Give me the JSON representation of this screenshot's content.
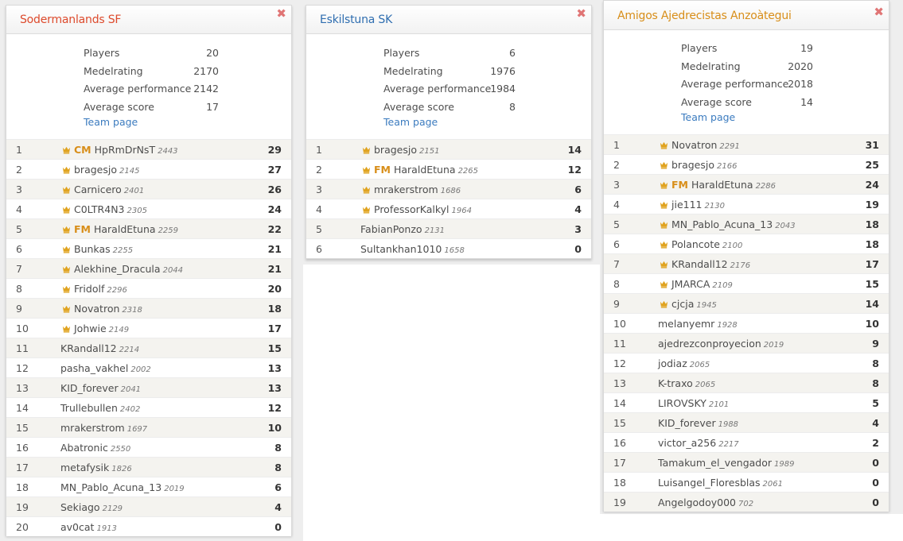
{
  "colors": {
    "team1_title": "#dd4a2c",
    "team2_title": "#2f6eb0",
    "team3_title": "#d88e19",
    "crown": "#e0a31f",
    "title_badge": "#d88e19",
    "link": "#3b7bbf",
    "close": "#e07575"
  },
  "icons": {
    "close": "close-icon",
    "crown": "crown-icon"
  },
  "labels": {
    "players": "Players",
    "medelrating": "Medelrating",
    "average_performance": "Average performance",
    "average_score": "Average score",
    "team_page": "Team page",
    "close_glyph": "✖"
  },
  "teams": [
    {
      "name": "Sodermanlands SF",
      "stats": {
        "players": "20",
        "medelrating": "2170",
        "average_performance": "2142",
        "average_score": "17"
      },
      "players": [
        {
          "rank": "1",
          "crown": true,
          "title": "CM",
          "name": "HpRmDrNsT",
          "rating": "2443",
          "score": "29"
        },
        {
          "rank": "2",
          "crown": true,
          "title": "",
          "name": "bragesjo",
          "rating": "2145",
          "score": "27"
        },
        {
          "rank": "3",
          "crown": true,
          "title": "",
          "name": "Carnicero",
          "rating": "2401",
          "score": "26"
        },
        {
          "rank": "4",
          "crown": true,
          "title": "",
          "name": "C0LTR4N3",
          "rating": "2305",
          "score": "24"
        },
        {
          "rank": "5",
          "crown": true,
          "title": "FM",
          "name": "HaraldEtuna",
          "rating": "2259",
          "score": "22"
        },
        {
          "rank": "6",
          "crown": true,
          "title": "",
          "name": "Bunkas",
          "rating": "2255",
          "score": "21"
        },
        {
          "rank": "7",
          "crown": true,
          "title": "",
          "name": "Alekhine_Dracula",
          "rating": "2044",
          "score": "21"
        },
        {
          "rank": "8",
          "crown": true,
          "title": "",
          "name": "Fridolf",
          "rating": "2296",
          "score": "20"
        },
        {
          "rank": "9",
          "crown": true,
          "title": "",
          "name": "Novatron",
          "rating": "2318",
          "score": "18"
        },
        {
          "rank": "10",
          "crown": true,
          "title": "",
          "name": "Johwie",
          "rating": "2149",
          "score": "17"
        },
        {
          "rank": "11",
          "crown": false,
          "title": "",
          "name": "KRandall12",
          "rating": "2214",
          "score": "15"
        },
        {
          "rank": "12",
          "crown": false,
          "title": "",
          "name": "pasha_vakhel",
          "rating": "2002",
          "score": "13"
        },
        {
          "rank": "13",
          "crown": false,
          "title": "",
          "name": "KID_forever",
          "rating": "2041",
          "score": "13"
        },
        {
          "rank": "14",
          "crown": false,
          "title": "",
          "name": "Trullebullen",
          "rating": "2402",
          "score": "12"
        },
        {
          "rank": "15",
          "crown": false,
          "title": "",
          "name": "mrakerstrom",
          "rating": "1697",
          "score": "10"
        },
        {
          "rank": "16",
          "crown": false,
          "title": "",
          "name": "Abatronic",
          "rating": "2550",
          "score": "8"
        },
        {
          "rank": "17",
          "crown": false,
          "title": "",
          "name": "metafysik",
          "rating": "1826",
          "score": "8"
        },
        {
          "rank": "18",
          "crown": false,
          "title": "",
          "name": "MN_Pablo_Acuna_13",
          "rating": "2019",
          "score": "6"
        },
        {
          "rank": "19",
          "crown": false,
          "title": "",
          "name": "Sekiago",
          "rating": "2129",
          "score": "4"
        },
        {
          "rank": "20",
          "crown": false,
          "title": "",
          "name": "av0cat",
          "rating": "1913",
          "score": "0"
        }
      ]
    },
    {
      "name": "Eskilstuna SK",
      "stats": {
        "players": "6",
        "medelrating": "1976",
        "average_performance": "1984",
        "average_score": "8"
      },
      "players": [
        {
          "rank": "1",
          "crown": true,
          "title": "",
          "name": "bragesjo",
          "rating": "2151",
          "score": "14"
        },
        {
          "rank": "2",
          "crown": true,
          "title": "FM",
          "name": "HaraldEtuna",
          "rating": "2265",
          "score": "12"
        },
        {
          "rank": "3",
          "crown": true,
          "title": "",
          "name": "mrakerstrom",
          "rating": "1686",
          "score": "6"
        },
        {
          "rank": "4",
          "crown": true,
          "title": "",
          "name": "ProfessorKalkyl",
          "rating": "1964",
          "score": "4"
        },
        {
          "rank": "5",
          "crown": false,
          "title": "",
          "name": "FabianPonzo",
          "rating": "2131",
          "score": "3"
        },
        {
          "rank": "6",
          "crown": false,
          "title": "",
          "name": "Sultankhan1010",
          "rating": "1658",
          "score": "0"
        }
      ]
    },
    {
      "name": "Amigos Ajedrecistas Anzoàtegui",
      "stats": {
        "players": "19",
        "medelrating": "2020",
        "average_performance": "2018",
        "average_score": "14"
      },
      "players": [
        {
          "rank": "1",
          "crown": true,
          "title": "",
          "name": "Novatron",
          "rating": "2291",
          "score": "31"
        },
        {
          "rank": "2",
          "crown": true,
          "title": "",
          "name": "bragesjo",
          "rating": "2166",
          "score": "25"
        },
        {
          "rank": "3",
          "crown": true,
          "title": "FM",
          "name": "HaraldEtuna",
          "rating": "2286",
          "score": "24"
        },
        {
          "rank": "4",
          "crown": true,
          "title": "",
          "name": "jie111",
          "rating": "2130",
          "score": "19"
        },
        {
          "rank": "5",
          "crown": true,
          "title": "",
          "name": "MN_Pablo_Acuna_13",
          "rating": "2043",
          "score": "18"
        },
        {
          "rank": "6",
          "crown": true,
          "title": "",
          "name": "Polancote",
          "rating": "2100",
          "score": "18"
        },
        {
          "rank": "7",
          "crown": true,
          "title": "",
          "name": "KRandall12",
          "rating": "2176",
          "score": "17"
        },
        {
          "rank": "8",
          "crown": true,
          "title": "",
          "name": "JMARCA",
          "rating": "2109",
          "score": "15"
        },
        {
          "rank": "9",
          "crown": true,
          "title": "",
          "name": "cjcja",
          "rating": "1945",
          "score": "14"
        },
        {
          "rank": "10",
          "crown": false,
          "title": "",
          "name": "melanyemr",
          "rating": "1928",
          "score": "10"
        },
        {
          "rank": "11",
          "crown": false,
          "title": "",
          "name": "ajedrezconproyecion",
          "rating": "2019",
          "score": "9"
        },
        {
          "rank": "12",
          "crown": false,
          "title": "",
          "name": "jodiaz",
          "rating": "2065",
          "score": "8"
        },
        {
          "rank": "13",
          "crown": false,
          "title": "",
          "name": "K-traxo",
          "rating": "2065",
          "score": "8"
        },
        {
          "rank": "14",
          "crown": false,
          "title": "",
          "name": "LIROVSKY",
          "rating": "2101",
          "score": "5"
        },
        {
          "rank": "15",
          "crown": false,
          "title": "",
          "name": "KID_forever",
          "rating": "1988",
          "score": "4"
        },
        {
          "rank": "16",
          "crown": false,
          "title": "",
          "name": "victor_a256",
          "rating": "2217",
          "score": "2"
        },
        {
          "rank": "17",
          "crown": false,
          "title": "",
          "name": "Tamakum_el_vengador",
          "rating": "1989",
          "score": "0"
        },
        {
          "rank": "18",
          "crown": false,
          "title": "",
          "name": "Luisangel_Floresblas",
          "rating": "2061",
          "score": "0"
        },
        {
          "rank": "19",
          "crown": false,
          "title": "",
          "name": "Angelgodoy000",
          "rating": "702",
          "score": "0"
        }
      ]
    }
  ]
}
